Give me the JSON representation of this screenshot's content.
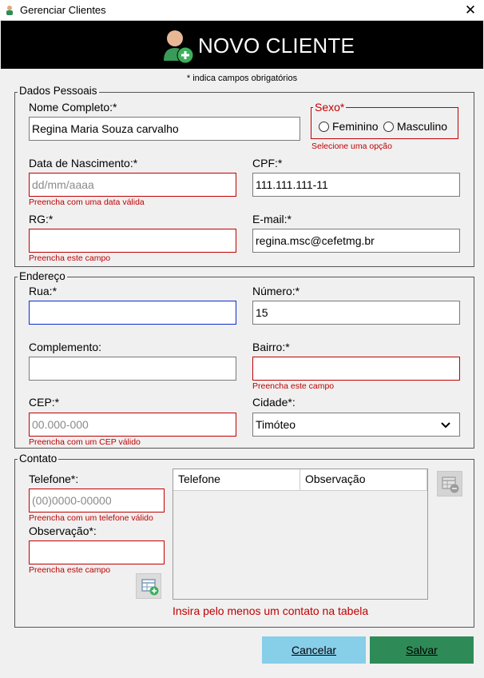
{
  "window": {
    "title": "Gerenciar Clientes",
    "close_symbol": "✕"
  },
  "header": {
    "title": "NOVO CLIENTE",
    "icon": "add-user-icon"
  },
  "required_note": "* indica campos obrigatórios",
  "dados_pessoais": {
    "legend": "Dados Pessoais",
    "nome": {
      "label": "Nome Completo:*",
      "value": "Regina Maria Souza carvalho"
    },
    "sexo": {
      "legend": "Sexo*",
      "options": [
        "Feminino",
        "Masculino"
      ],
      "selected": null,
      "error": "Selecione uma opção"
    },
    "data_nascimento": {
      "label": "Data de Nascimento:*",
      "placeholder": "dd/mm/aaaa",
      "value": "",
      "error": "Preencha com uma data válida"
    },
    "cpf": {
      "label": "CPF:*",
      "value": "111.111.111-11"
    },
    "rg": {
      "label": "RG:*",
      "value": "",
      "error": "Preencha este campo"
    },
    "email": {
      "label": "E-mail:*",
      "value": "regina.msc@cefetmg.br"
    }
  },
  "endereco": {
    "legend": "Endereço",
    "rua": {
      "label": "Rua:*",
      "value": ""
    },
    "numero": {
      "label": "Número:*",
      "value": "15"
    },
    "complemento": {
      "label": "Complemento:",
      "value": ""
    },
    "bairro": {
      "label": "Bairro:*",
      "value": "",
      "error": "Preencha este campo"
    },
    "cep": {
      "label": "CEP:*",
      "placeholder": "00.000-000",
      "value": "",
      "error": "Preencha com um CEP válido"
    },
    "cidade": {
      "label": "Cidade*:",
      "value": "Timóteo"
    }
  },
  "contato": {
    "legend": "Contato",
    "telefone": {
      "label": "Telefone*:",
      "placeholder": "(00)0000-00000",
      "value": "",
      "error": "Preencha com um telefone válido"
    },
    "observacao": {
      "label": "Observação*:",
      "value": "",
      "error": "Preencha este campo"
    },
    "table": {
      "columns": [
        "Telefone",
        "Observação"
      ],
      "rows": []
    },
    "table_error": "Insira pelo menos um contato na tabela",
    "add_icon": "table-add-icon",
    "remove_icon": "table-remove-icon"
  },
  "buttons": {
    "cancel": "Cancelar",
    "save": "Salvar"
  },
  "colors": {
    "error": "#c00000",
    "cancel_bg": "#87cee9",
    "save_bg": "#2e8b57",
    "header_bg": "#000000",
    "focus_border": "#0a2ecc"
  }
}
